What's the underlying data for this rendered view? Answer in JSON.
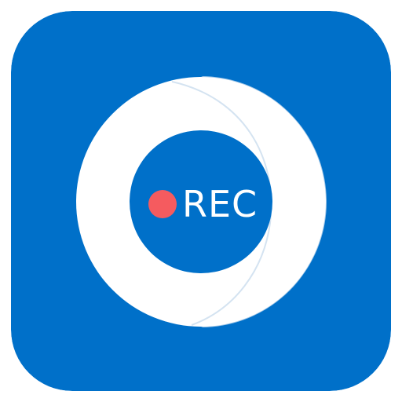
{
  "icon": {
    "name": "screen-recorder-icon",
    "label": "REC",
    "colors": {
      "background": "#0070C9",
      "ring": "#FFFFFF",
      "ring_shadow": "#D7E4F2",
      "inner_disc": "#0070C9",
      "record_dot": "#F55B5F",
      "label": "#FFFFFF"
    }
  }
}
